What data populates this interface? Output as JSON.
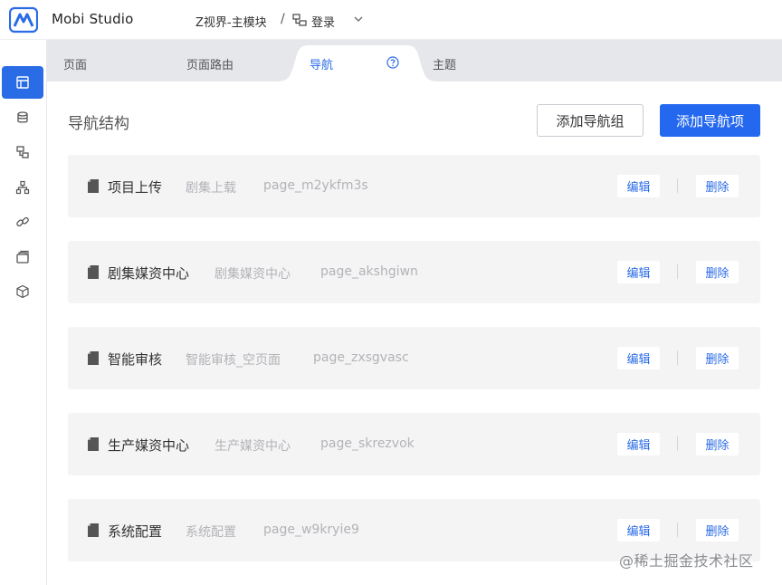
{
  "app": {
    "name": "Mobi Studio"
  },
  "breadcrumb": {
    "project": "Z视界-主模块",
    "separator": "/",
    "page": "登录"
  },
  "sidebar": {
    "items": [
      {
        "icon": "layout-icon",
        "active": true
      },
      {
        "icon": "database-icon",
        "active": false
      },
      {
        "icon": "pages-icon",
        "active": false
      },
      {
        "icon": "org-tree-icon",
        "active": false
      },
      {
        "icon": "link-icon",
        "active": false
      },
      {
        "icon": "stack-icon",
        "active": false
      },
      {
        "icon": "cube-icon",
        "active": false
      }
    ]
  },
  "tabs": [
    {
      "label": "页面",
      "active": false
    },
    {
      "label": "页面路由",
      "active": false
    },
    {
      "label": "导航",
      "active": true
    },
    {
      "label": "主题",
      "active": false
    }
  ],
  "main": {
    "title": "导航结构",
    "add_group_label": "添加导航组",
    "add_item_label": "添加导航项"
  },
  "nav_items": [
    {
      "name": "项目上传",
      "title": "剧集上载",
      "code": "page_m2ykfm3s",
      "edit_label": "编辑",
      "delete_label": "删除"
    },
    {
      "name": "剧集媒资中心",
      "title": "剧集媒资中心",
      "code": "page_akshgiwn",
      "edit_label": "编辑",
      "delete_label": "删除"
    },
    {
      "name": "智能审核",
      "title": "智能审核_空页面",
      "code": "page_zxsgvasc",
      "edit_label": "编辑",
      "delete_label": "删除"
    },
    {
      "name": "生产媒资中心",
      "title": "生产媒资中心",
      "code": "page_skrezvok",
      "edit_label": "编辑",
      "delete_label": "删除"
    },
    {
      "name": "系统配置",
      "title": "系统配置",
      "code": "page_w9kryie9",
      "edit_label": "编辑",
      "delete_label": "删除"
    }
  ],
  "watermark": "@稀土掘金技术社区",
  "colors": {
    "primary": "#2468ef",
    "row_bg": "#f4f4f5",
    "tab_bar": "#e5e7eb"
  }
}
